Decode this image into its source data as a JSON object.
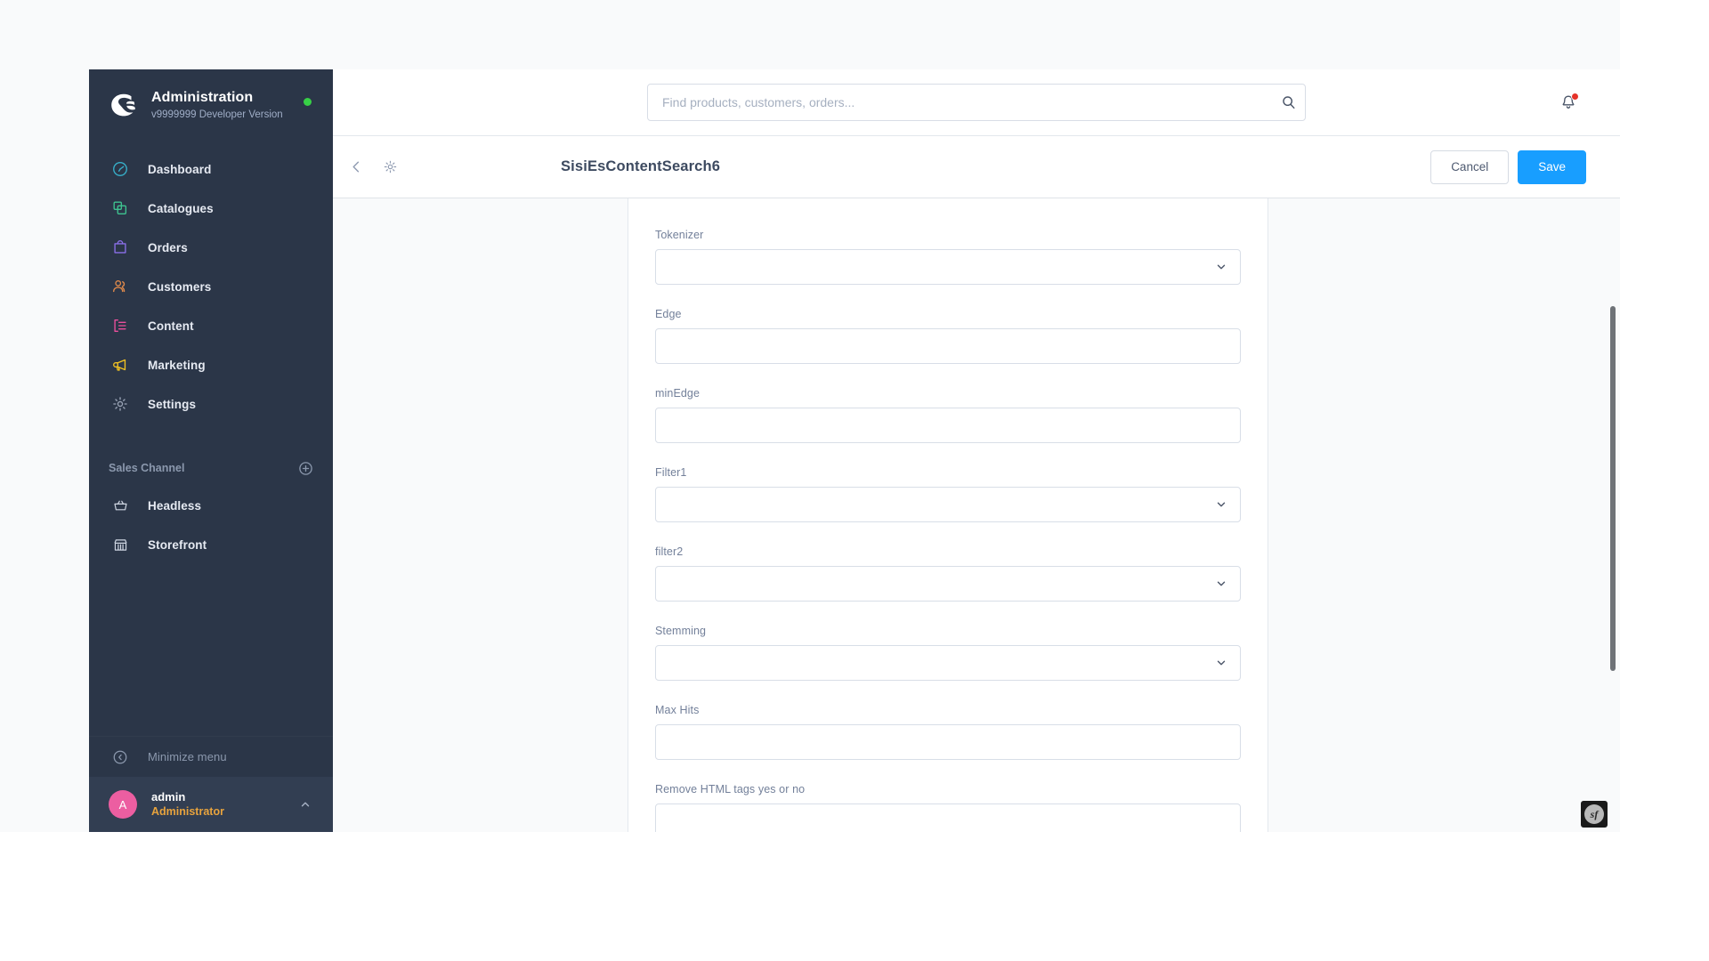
{
  "sidebar": {
    "brand": {
      "logo_icon": "shopware-logo-icon",
      "title": "Administration",
      "version": "v9999999 Developer Version",
      "status_dot_color": "#37d046"
    },
    "nav": [
      {
        "label": "Dashboard",
        "icon": "dashboard-icon",
        "color": "#37afc9"
      },
      {
        "label": "Catalogues",
        "icon": "catalogues-icon",
        "color": "#3ec28f"
      },
      {
        "label": "Orders",
        "icon": "orders-icon",
        "color": "#8a6fe8"
      },
      {
        "label": "Customers",
        "icon": "customers-icon",
        "color": "#e08a4b"
      },
      {
        "label": "Content",
        "icon": "content-icon",
        "color": "#ea4f9c"
      },
      {
        "label": "Marketing",
        "icon": "marketing-icon",
        "color": "#f2c222"
      },
      {
        "label": "Settings",
        "icon": "settings-gear-icon",
        "color": "#9aa4b6"
      }
    ],
    "sales_channel": {
      "section_label": "Sales Channel",
      "add_icon": "plus-circle-icon",
      "items": [
        {
          "label": "Headless",
          "icon": "basket-icon"
        },
        {
          "label": "Storefront",
          "icon": "storefront-icon"
        }
      ]
    },
    "minimize": {
      "label": "Minimize menu",
      "icon": "chevron-left-circle-icon"
    },
    "user": {
      "avatar_initial": "A",
      "avatar_color": "#ec5ea1",
      "name": "admin",
      "role": "Administrator",
      "caret_icon": "chevron-up-icon"
    }
  },
  "topbar": {
    "search": {
      "placeholder": "Find products, customers, orders...",
      "value": "",
      "icon": "search-icon"
    },
    "notifications": {
      "icon": "bell-icon",
      "has_unread": true,
      "dot_color": "#e6332a"
    }
  },
  "page_header": {
    "back_icon": "chevron-left-icon",
    "settings_icon": "gear-icon",
    "title": "SisiEsContentSearch6",
    "cancel_label": "Cancel",
    "save_label": "Save",
    "save_color": "#189eff"
  },
  "form": {
    "fields": [
      {
        "label": "Tokenizer",
        "type": "select",
        "value": ""
      },
      {
        "label": "Edge",
        "type": "text",
        "value": ""
      },
      {
        "label": "minEdge",
        "type": "text",
        "value": ""
      },
      {
        "label": "Filter1",
        "type": "select",
        "value": ""
      },
      {
        "label": "filter2",
        "type": "select",
        "value": ""
      },
      {
        "label": "Stemming",
        "type": "select",
        "value": ""
      },
      {
        "label": "Max Hits",
        "type": "text",
        "value": ""
      },
      {
        "label": "Remove HTML tags yes or no",
        "type": "text",
        "value": ""
      }
    ]
  },
  "scrollbar": {
    "thumb_color": "#6e7277"
  },
  "debug_badge": {
    "label": "sf",
    "title": "Symfony Profiler"
  }
}
